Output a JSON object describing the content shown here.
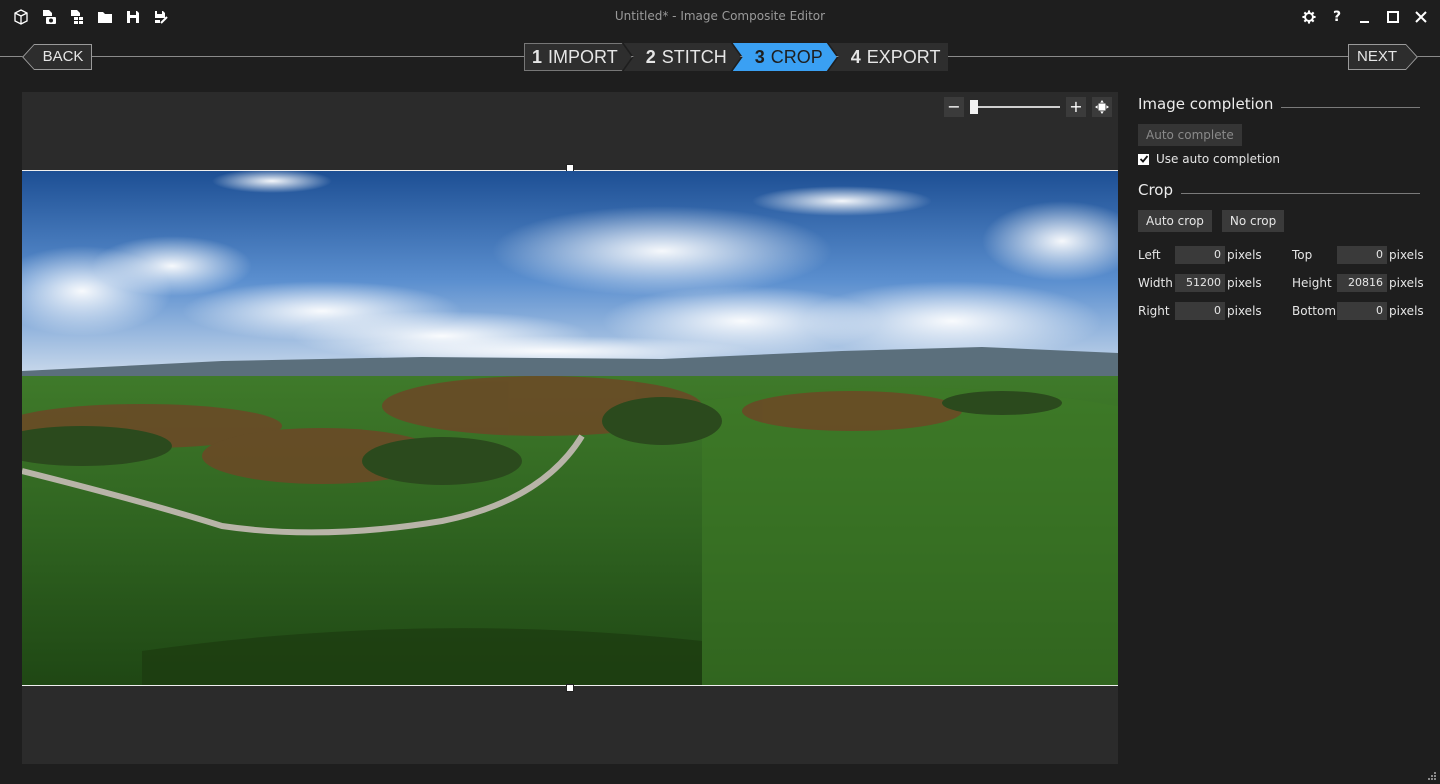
{
  "window": {
    "title": "Untitled* - Image Composite Editor",
    "toolbar_icons": [
      "new-panorama-icon",
      "new-from-video-icon",
      "new-from-images-icon",
      "open-icon",
      "save-icon",
      "save-as-icon"
    ],
    "controls": [
      "settings-icon",
      "help-icon",
      "minimize-icon",
      "maximize-icon",
      "close-icon"
    ],
    "help_label": "?"
  },
  "wizard": {
    "back_label": "BACK",
    "next_label": "NEXT",
    "steps": [
      {
        "num": "1",
        "label": "IMPORT"
      },
      {
        "num": "2",
        "label": "STITCH"
      },
      {
        "num": "3",
        "label": "CROP"
      },
      {
        "num": "4",
        "label": "EXPORT"
      }
    ],
    "active_step": "3",
    "accent_color": "#3aa0f3"
  },
  "zoom": {
    "minus_label": "−",
    "plus_label": "+",
    "level": 0.0
  },
  "image_completion": {
    "title": "Image completion",
    "auto_complete_label": "Auto complete",
    "use_auto_label": "Use auto completion",
    "use_auto_checked": true
  },
  "crop": {
    "title": "Crop",
    "auto_crop_label": "Auto crop",
    "no_crop_label": "No crop",
    "left_label": "Left",
    "left_value": "0",
    "top_label": "Top",
    "top_value": "0",
    "width_label": "Width",
    "width_value": "51200",
    "height_label": "Height",
    "height_value": "20816",
    "right_label": "Right",
    "right_value": "0",
    "bottom_label": "Bottom",
    "bottom_value": "0",
    "unit": "pixels"
  }
}
